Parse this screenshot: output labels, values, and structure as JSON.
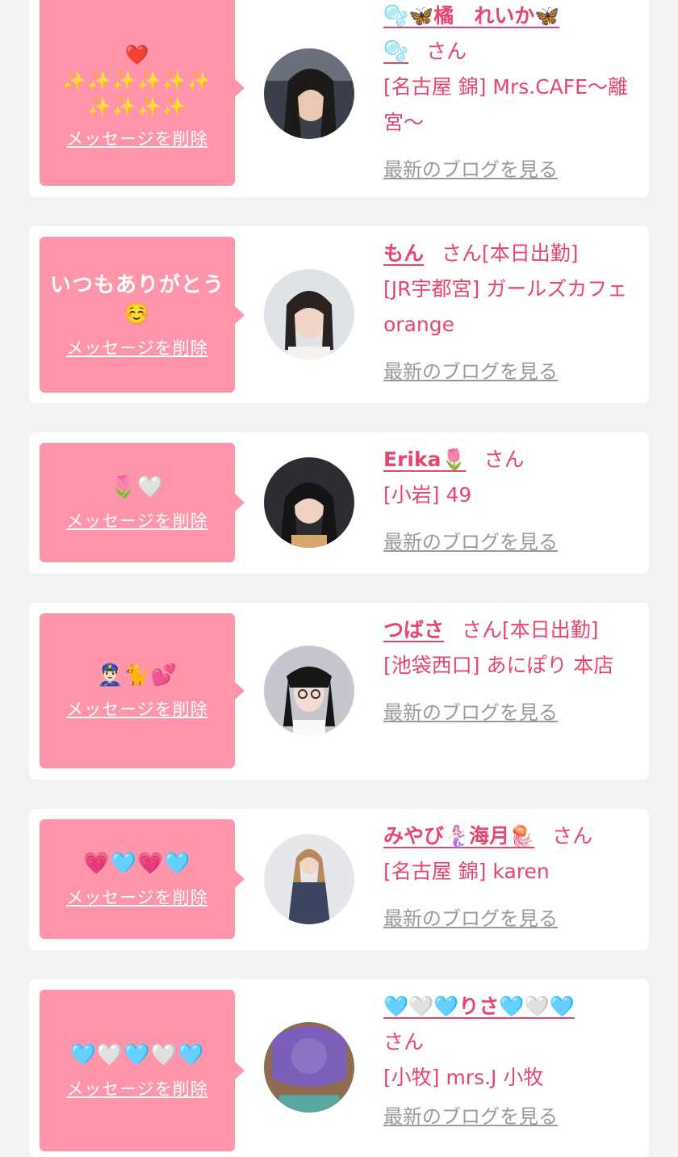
{
  "delete_label": "メッセージを削除",
  "blog_label": "最新のブログを見る",
  "san_label": "さん",
  "colors": {
    "background": "#f2f2f2",
    "card": "#ffffff",
    "bubble": "#ff95aa",
    "accent": "#e8456e",
    "link_gray": "#9a9a9a"
  },
  "cards": [
    {
      "message": "❤️\n✨✨✨✨✨✨\n✨✨✨✨",
      "name": "🫧🦋橘　れいか🦋\n🫧",
      "status": "",
      "shop": "[名古屋 錦] Mrs.CAFE〜離宮〜"
    },
    {
      "message": "いつもありがとう\n☺️",
      "name": "もん",
      "status": "[本日出勤]",
      "shop": "[JR宇都宮] ガールズカフェ orange"
    },
    {
      "message": "🌷🤍",
      "name": "Erika🌷",
      "status": "",
      "shop": "[小岩] 49"
    },
    {
      "message": "👮🏻‍♂️🐈💕",
      "name": "つばさ",
      "status": "[本日出勤]",
      "shop": "[池袋西口] あにぽり 本店"
    },
    {
      "message": "💗🩵💗🩵",
      "name": "みやび🧜🏻‍♀️海月🪼",
      "status": "",
      "shop": "[名古屋 錦] karen"
    },
    {
      "message": "🩵🤍🩵🤍🩵",
      "name": "🩵🤍🩵りさ🩵🤍🩵",
      "status": "",
      "shop": "[小牧] mrs.J 小牧"
    }
  ]
}
